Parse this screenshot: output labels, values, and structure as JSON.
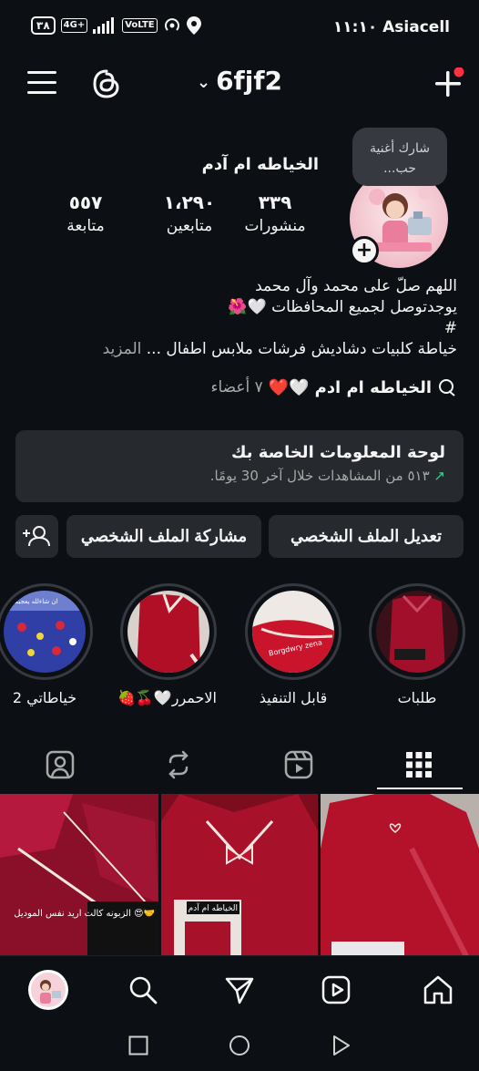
{
  "status_bar": {
    "battery": "٣٨",
    "network": "4G+",
    "volte": "VoLTE",
    "time_carrier": "١١:١٠ Asiacell"
  },
  "header": {
    "username": "6fjf2",
    "notification_dot_color": "#ff3040"
  },
  "profile": {
    "display_name": "الخياطه ام آدم",
    "note_bubble": "شارك أغنية حب...",
    "stats": [
      {
        "value": "٣٣٩",
        "label": "منشورات"
      },
      {
        "value": "١،٢٩٠",
        "label": "متابعين"
      },
      {
        "value": "٥٥٧",
        "label": "متابعة"
      }
    ],
    "bio_lines": [
      "اللهم صلّ على محمد وآل محمد",
      "يوجدتوصل لجميع المحافظات 🤍🌺",
      "#",
      "خياطة كلبيات دشاديش فرشات ملابس اطفال ..."
    ],
    "bio_more": "المزيد",
    "community": {
      "name": "الخياطه ام ادم",
      "hearts": "🤍❤️",
      "members": "٧ أعضاء"
    }
  },
  "dashboard": {
    "title": "لوحة المعلومات الخاصة بك",
    "subtitle": "٥١٣ من المشاهدات خلال آخر 30 يومًا.",
    "arrow": "↗",
    "accent": "#3dd28e"
  },
  "buttons": {
    "edit_profile": "تعديل الملف الشخصي",
    "share_profile": "مشاركة الملف الشخصي"
  },
  "highlights": [
    {
      "label": "طلبات"
    },
    {
      "label": "قابل التنفيذ"
    },
    {
      "label": "الاحمرر🤍🍒🍓"
    },
    {
      "label": "خياطاتي 2"
    }
  ],
  "highlight_overlay_texts": {
    "h2": "Borgdwry zena",
    "h4": "ان شاءلله يعجبكم"
  },
  "posts": [
    {
      "overlay": "الزبونه كالت اريد نفس الموديل 😍🤝"
    },
    {
      "overlay": "الخياطه ام آدم"
    },
    {
      "overlay": ""
    }
  ],
  "tabs": [
    "tagged",
    "reposts",
    "reels",
    "grid"
  ],
  "colors": {
    "background": "#0c1014",
    "surface": "#262a2f",
    "text": "#f5f5f5",
    "muted": "#a8a8a8",
    "fabric_red": "#b0102a"
  }
}
